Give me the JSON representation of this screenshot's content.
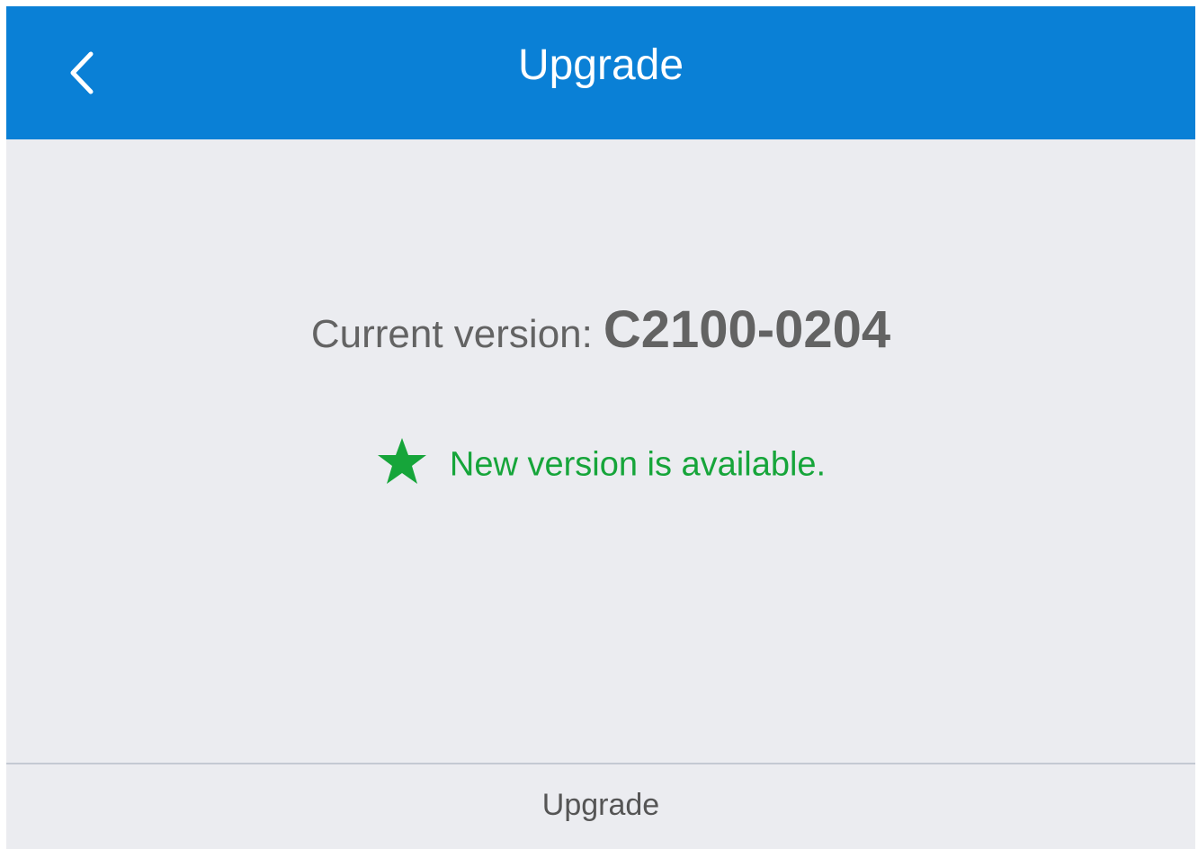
{
  "header": {
    "title": "Upgrade",
    "back_icon": "chevron-left-icon"
  },
  "version": {
    "label": "Current version:",
    "value": "C2100-0204"
  },
  "status": {
    "icon": "star-icon",
    "text": "New version is available."
  },
  "footer": {
    "upgrade_label": "Upgrade"
  },
  "colors": {
    "header_bg": "#0a80d6",
    "page_bg": "#ebecf0",
    "status_green": "#16a53a",
    "text_gray": "#636363"
  }
}
